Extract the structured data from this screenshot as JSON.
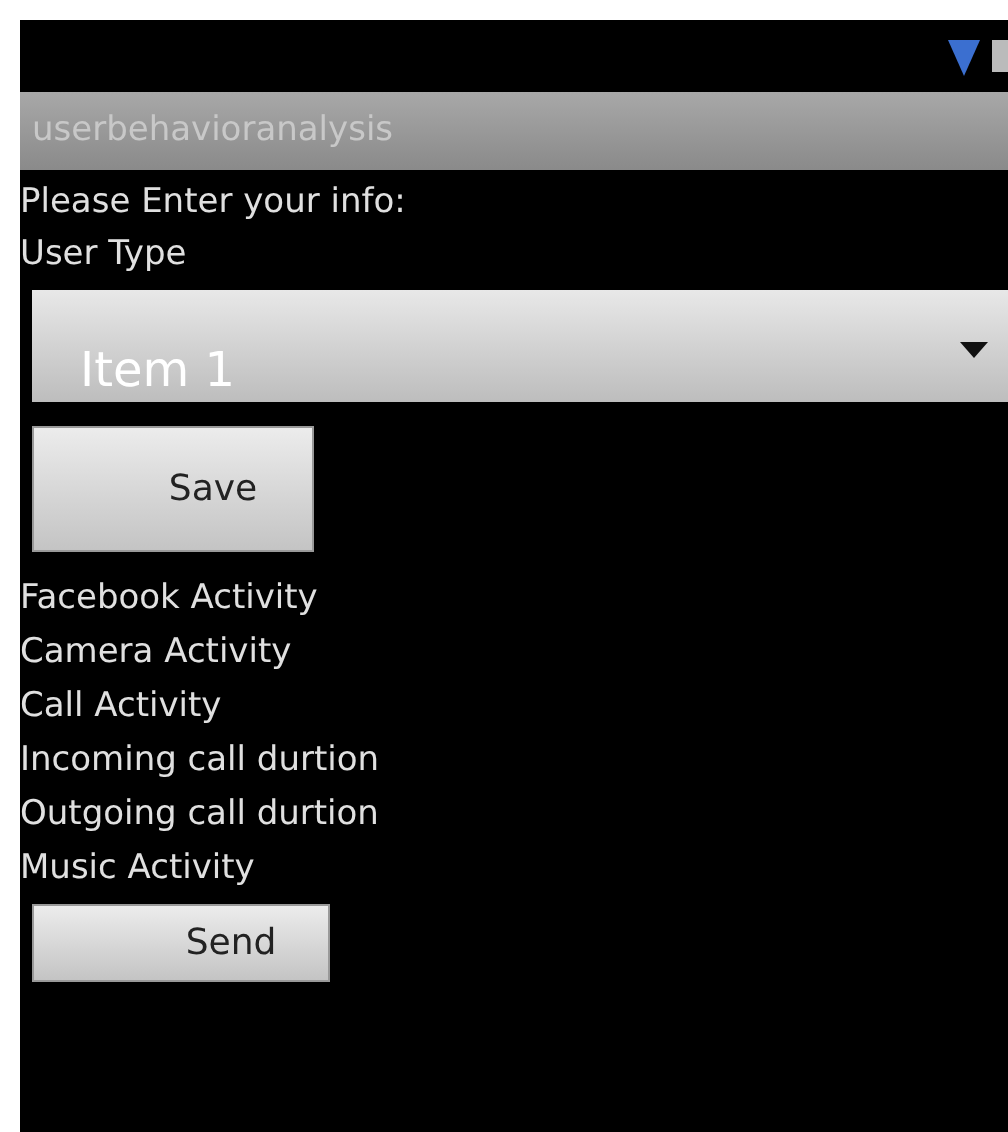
{
  "app_bar": {
    "title": "userbehavioranalysis"
  },
  "prompt": "Please Enter your info:",
  "user_type_label": "User Type",
  "user_type_spinner": {
    "value": "Item 1"
  },
  "save_button": "Save",
  "activities": [
    "Facebook Activity",
    "Camera Activity",
    "Call Activity",
    "Incoming call durtion",
    "Outgoing call durtion",
    "Music Activity"
  ],
  "send_button": "Send"
}
